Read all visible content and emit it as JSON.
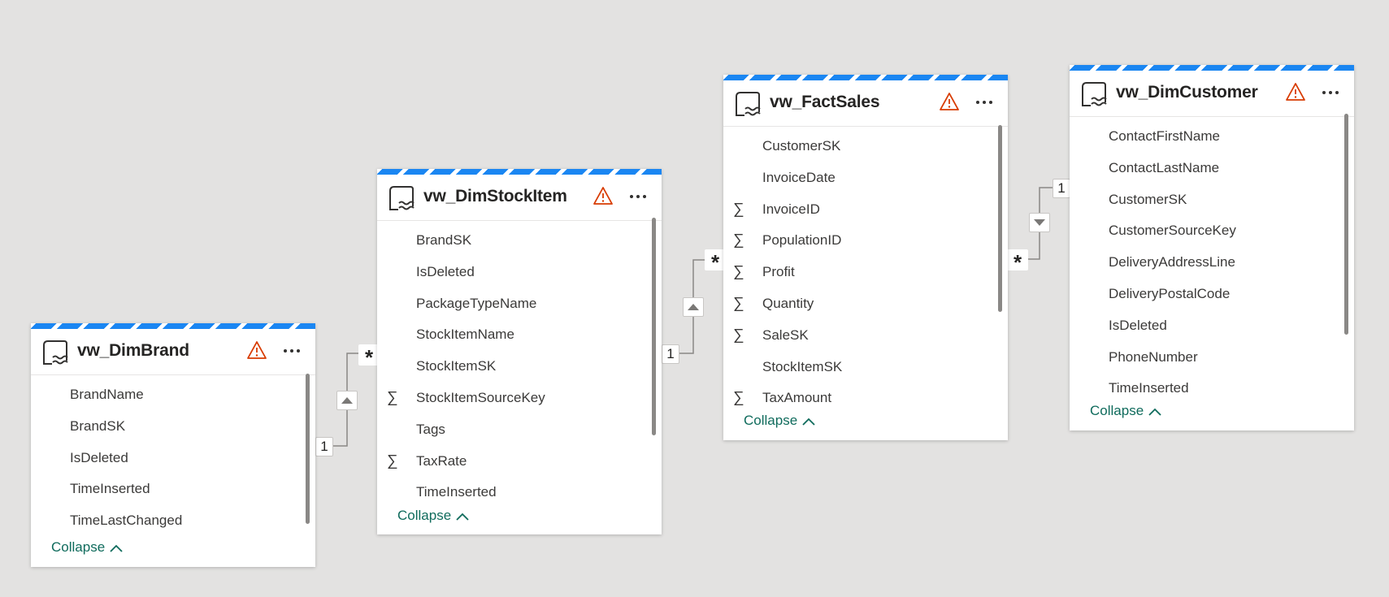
{
  "tables": [
    {
      "name": "vw_DimBrand",
      "fields": [
        {
          "label": "BrandName",
          "sum": false
        },
        {
          "label": "BrandSK",
          "sum": false
        },
        {
          "label": "IsDeleted",
          "sum": false
        },
        {
          "label": "TimeInserted",
          "sum": false
        },
        {
          "label": "TimeLastChanged",
          "sum": false
        }
      ],
      "collapse_label": "Collapse"
    },
    {
      "name": "vw_DimStockItem",
      "fields": [
        {
          "label": "BrandSK",
          "sum": false
        },
        {
          "label": "IsDeleted",
          "sum": false
        },
        {
          "label": "PackageTypeName",
          "sum": false
        },
        {
          "label": "StockItemName",
          "sum": false
        },
        {
          "label": "StockItemSK",
          "sum": false
        },
        {
          "label": "StockItemSourceKey",
          "sum": true
        },
        {
          "label": "Tags",
          "sum": false
        },
        {
          "label": "TaxRate",
          "sum": true
        },
        {
          "label": "TimeInserted",
          "sum": false
        }
      ],
      "collapse_label": "Collapse"
    },
    {
      "name": "vw_FactSales",
      "fields": [
        {
          "label": "CustomerSK",
          "sum": false
        },
        {
          "label": "InvoiceDate",
          "sum": false
        },
        {
          "label": "InvoiceID",
          "sum": true
        },
        {
          "label": "PopulationID",
          "sum": true
        },
        {
          "label": "Profit",
          "sum": true
        },
        {
          "label": "Quantity",
          "sum": true
        },
        {
          "label": "SaleSK",
          "sum": true
        },
        {
          "label": "StockItemSK",
          "sum": false
        },
        {
          "label": "TaxAmount",
          "sum": true
        }
      ],
      "collapse_label": "Collapse"
    },
    {
      "name": "vw_DimCustomer",
      "fields": [
        {
          "label": "ContactFirstName",
          "sum": false
        },
        {
          "label": "ContactLastName",
          "sum": false
        },
        {
          "label": "CustomerSK",
          "sum": false
        },
        {
          "label": "CustomerSourceKey",
          "sum": false
        },
        {
          "label": "DeliveryAddressLine",
          "sum": false
        },
        {
          "label": "DeliveryPostalCode",
          "sum": false
        },
        {
          "label": "IsDeleted",
          "sum": false
        },
        {
          "label": "PhoneNumber",
          "sum": false
        },
        {
          "label": "TimeInserted",
          "sum": false
        }
      ],
      "collapse_label": "Collapse"
    }
  ],
  "relationships": [
    {
      "one_label": "1",
      "many_label": "*",
      "direction": "up"
    },
    {
      "one_label": "1",
      "many_label": "*",
      "direction": "up"
    },
    {
      "one_label": "1",
      "many_label": "*",
      "direction": "down"
    }
  ],
  "sum_symbol": "∑",
  "icons": {
    "table": "lakehouse-table-icon",
    "warning": "warning-icon",
    "more": "more-options-icon",
    "collapse": "chevron-up-icon"
  },
  "colors": {
    "accent_stripe": "#1a86f2",
    "warning": "#d83b01",
    "collapse_link": "#0f6b5c",
    "canvas": "#e3e2e1"
  }
}
